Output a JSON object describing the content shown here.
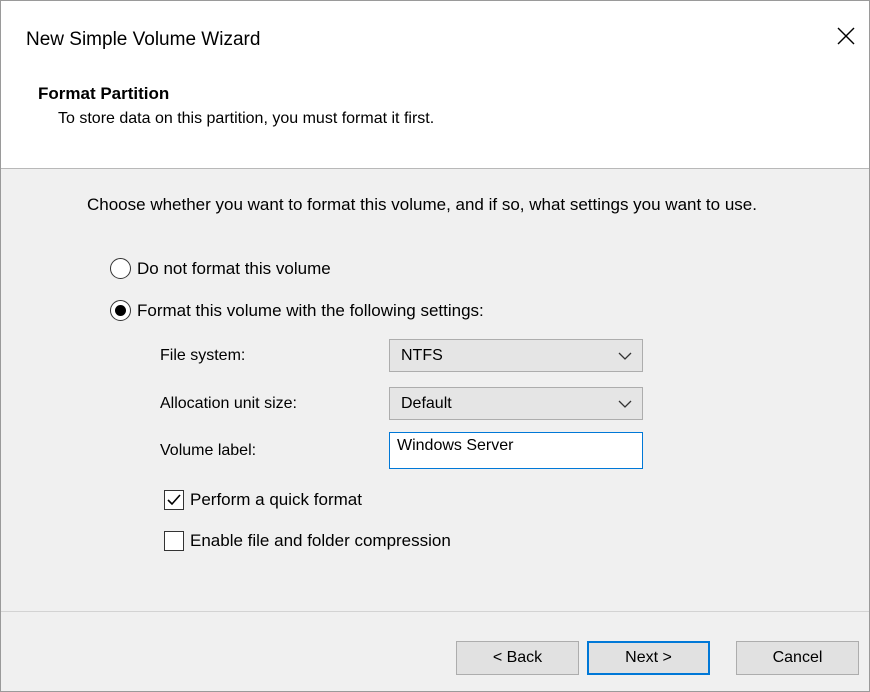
{
  "window": {
    "title": "New Simple Volume Wizard"
  },
  "header": {
    "title": "Format Partition",
    "subtitle": "To store data on this partition, you must format it first."
  },
  "content": {
    "instruction": "Choose whether you want to format this volume, and if so, what settings you want to use.",
    "options": {
      "no_format": {
        "label": "Do not format this volume",
        "selected": false
      },
      "format": {
        "label": "Format this volume with the following settings:",
        "selected": true
      }
    },
    "file_system": {
      "label": "File system:",
      "value": "NTFS"
    },
    "allocation_unit": {
      "label": "Allocation unit size:",
      "value": "Default"
    },
    "volume_label": {
      "label": "Volume label:",
      "value": "Windows Server"
    },
    "quick_format": {
      "label": "Perform a quick format",
      "checked": true
    },
    "compression": {
      "label": "Enable file and folder compression",
      "checked": false
    }
  },
  "footer": {
    "back_label": "< Back",
    "next_label": "Next >",
    "cancel_label": "Cancel"
  },
  "icons": {
    "close": "close-icon",
    "dropdown": "chevron-down-icon",
    "check": "checkmark-icon"
  },
  "colors": {
    "accent": "#0078d7",
    "dialog_background": "#f0f0f0",
    "header_background": "#ffffff",
    "button_face": "#e1e1e1"
  }
}
